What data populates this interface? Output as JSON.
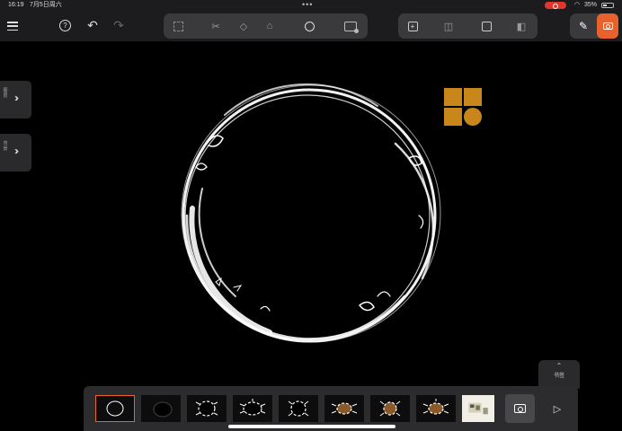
{
  "status_bar": {
    "time": "16:19",
    "date": "7月5日周六",
    "battery_percent": "35%",
    "battery_level": 0.35
  },
  "toolbar": {
    "left_icons": [
      "menu-icon",
      "app-logo-icon",
      "help-icon",
      "undo-icon",
      "redo-icon"
    ],
    "center_tools": [
      "select-icon",
      "cut-icon",
      "eraser-icon",
      "fill-icon",
      "brush-size-icon",
      "insert-image-icon"
    ],
    "frame_tools": [
      "add-frame-icon",
      "duplicate-frame-icon",
      "copy-frame-icon",
      "delete-frame-icon"
    ],
    "right_tools": [
      "pencil-icon",
      "camera-icon"
    ],
    "accent_color": "#e8622e"
  },
  "side_tabs": [
    {
      "label": "图层",
      "icon": "double-chevron-right-icon"
    },
    {
      "label": "背景",
      "icon": "double-chevron-right-icon"
    }
  ],
  "canvas": {
    "background": "#000000",
    "logo_color": "#c9861a"
  },
  "bookmark": {
    "label": "书签",
    "icon": "chevron-up-down-icon"
  },
  "filmstrip": {
    "frame_count": 9,
    "selected_index": 0,
    "thumbnails": [
      "ring",
      "dark-oval",
      "sparkle-oval",
      "sparkle-oval",
      "sparkle-oval",
      "sparkle-oval-texture",
      "sparkle-oval-texture",
      "sparkle-oval-texture",
      "photo"
    ],
    "play_icon": "play-icon"
  }
}
